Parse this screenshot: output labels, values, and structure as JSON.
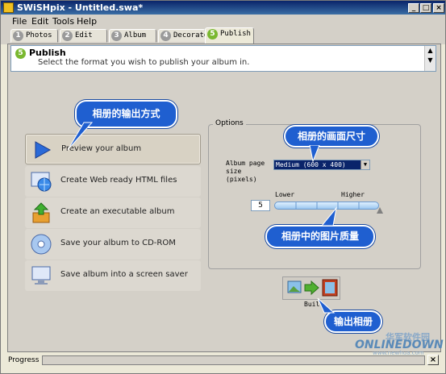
{
  "window": {
    "title": "SWiSHpix - Untitled.swa*",
    "controls": [
      "_",
      "□",
      "×"
    ]
  },
  "menu": [
    "File",
    "Edit",
    "Tools",
    "Help"
  ],
  "tabs": [
    {
      "num": "1",
      "label": "Photos"
    },
    {
      "num": "2",
      "label": "Edit"
    },
    {
      "num": "3",
      "label": "Album"
    },
    {
      "num": "4",
      "label": "Decorate"
    },
    {
      "num": "5",
      "label": "Publish",
      "active": true
    }
  ],
  "header": {
    "num": "5",
    "title": "Publish",
    "subtitle": "Select the format you wish to publish your album in."
  },
  "publish_options": [
    {
      "label": "Preview your album",
      "icon": "play-arrow-icon",
      "selected": true
    },
    {
      "label": "Create Web ready HTML files",
      "icon": "globe-monitor-icon"
    },
    {
      "label": "Create an executable album",
      "icon": "install-package-icon"
    },
    {
      "label": "Save your album to CD-ROM",
      "icon": "cd-rom-icon"
    },
    {
      "label": "Save album into a screen saver",
      "icon": "monitor-icon"
    }
  ],
  "options": {
    "legend": "Options",
    "size_label": "Album page size (pixels)",
    "size_value": "Medium (600 x 400)",
    "quality_value": "5",
    "quality_min_label": "Lower",
    "quality_max_label": "Higher",
    "quality_level": 1.0
  },
  "build": {
    "label": "Buil"
  },
  "annotations": {
    "output_method": "相册的输出方式",
    "page_size": "相册的画面尺寸",
    "image_quality": "相册中的图片质量",
    "output_album": "输出相册"
  },
  "progress": {
    "label": "Progress",
    "close": "×"
  },
  "watermark": {
    "cn": "华军软件园",
    "en": "ONLINEDOWN",
    "url": "www.newhua.com"
  },
  "colors": {
    "callout": "#1f5fd0",
    "active_tab_badge": "#7ab830",
    "titlebar": "#0a246a"
  }
}
